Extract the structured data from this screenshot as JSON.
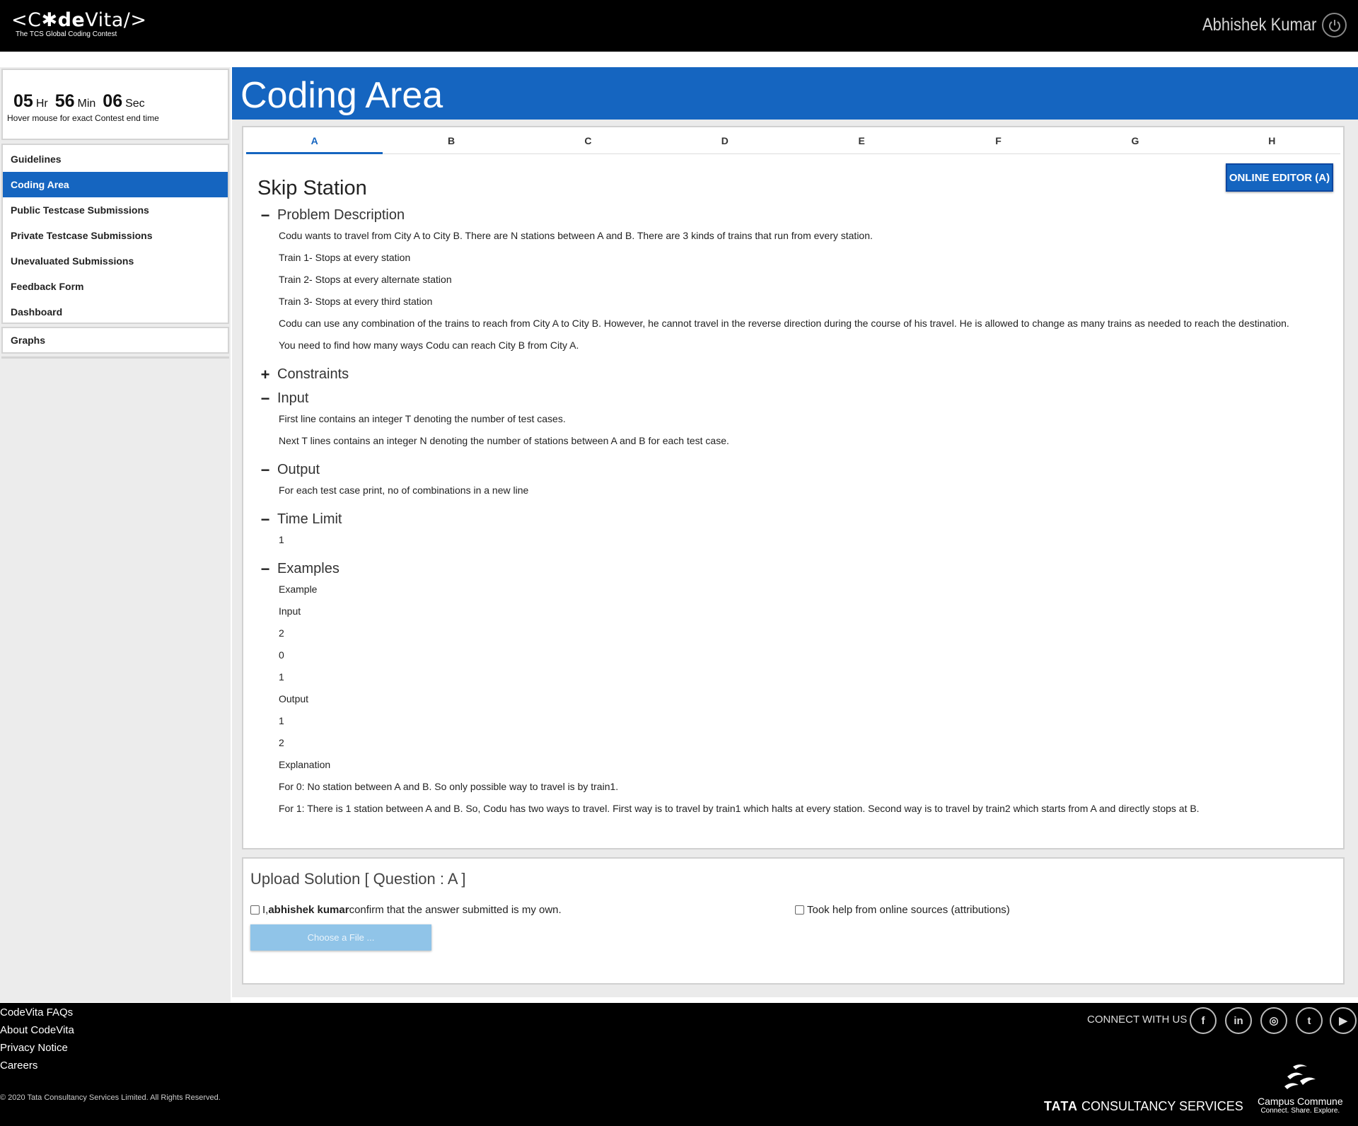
{
  "header": {
    "logo_text_1": "<C",
    "logo_star": "✱",
    "logo_text_2": "de",
    "logo_text_3": "Vita/>",
    "logo_sub": "The TCS Global Coding Contest",
    "user_name": "Abhishek Kumar"
  },
  "timer": {
    "hours": "05",
    "hr_unit": "Hr",
    "minutes": "56",
    "min_unit": "Min",
    "seconds": "06",
    "sec_unit": "Sec",
    "hint": "Hover mouse for exact Contest end time"
  },
  "sidebar": {
    "items": [
      {
        "label": "Guidelines"
      },
      {
        "label": "Coding Area"
      },
      {
        "label": "Public Testcase Submissions"
      },
      {
        "label": "Private Testcase Submissions"
      },
      {
        "label": "Unevaluated Submissions"
      },
      {
        "label": "Feedback Form"
      },
      {
        "label": "Dashboard"
      }
    ],
    "active_index": 1,
    "graphs": "Graphs"
  },
  "main": {
    "title": "Coding Area",
    "tabs": [
      "A",
      "B",
      "C",
      "D",
      "E",
      "F",
      "G",
      "H"
    ],
    "active_tab": "A",
    "editor_button": "ONLINE EDITOR (A)",
    "problem_title": "Skip Station",
    "sections": {
      "description": {
        "icon": "−",
        "title": "Problem Description",
        "lines": [
          "Codu wants to travel from City A to City B. There are N stations between A and B. There are 3 kinds of trains that run from every station.",
          "Train 1- Stops at every station",
          "Train 2- Stops at every alternate station",
          "Train 3- Stops at every third station",
          "Codu can use any combination of the trains to reach from City A to City B. However, he cannot travel in the reverse direction during the course of his travel. He is allowed to change as many trains as needed to reach the destination.",
          "You need to find how many ways Codu can reach City B from City A."
        ]
      },
      "constraints": {
        "icon": "+",
        "title": "Constraints"
      },
      "input": {
        "icon": "−",
        "title": "Input",
        "lines": [
          "First line contains an integer T denoting the number of test cases.",
          "Next T lines contains an integer N denoting the number of stations between A and B for each test case."
        ]
      },
      "output": {
        "icon": "−",
        "title": "Output",
        "lines": [
          "For each test case print, no of combinations in a new line"
        ]
      },
      "time_limit": {
        "icon": "−",
        "title": "Time Limit",
        "lines": [
          "1"
        ]
      },
      "examples": {
        "icon": "−",
        "title": "Examples",
        "lines": [
          "Example",
          "Input",
          "2",
          "0",
          "1",
          "Output",
          "1",
          "2",
          "Explanation",
          "For 0: No station between A and B. So only possible way to travel is by train1.",
          "For 1: There is 1 station between A and B. So, Codu has two ways to travel. First way is to travel by train1 which halts at every station. Second way is to travel by train2 which starts from A and directly stops at B."
        ]
      }
    }
  },
  "upload": {
    "title": "Upload Solution [ Question : A ]",
    "confirm_prefix": "I, ",
    "confirm_name": "abhishek kumar",
    "confirm_suffix": " confirm that the answer submitted is my own.",
    "help_label": "Took help from online sources (attributions)",
    "file_button": "Choose a File ..."
  },
  "footer": {
    "links": [
      "CodeVita FAQs",
      "About CodeVita",
      "Privacy Notice",
      "Careers"
    ],
    "copyright": "© 2020 Tata Consultancy Services Limited. All Rights Reserved.",
    "connect": "CONNECT WITH US",
    "social": [
      {
        "icon": "facebook-icon",
        "glyph": "f"
      },
      {
        "icon": "linkedin-icon",
        "glyph": "in"
      },
      {
        "icon": "instagram-icon",
        "glyph": "◎"
      },
      {
        "icon": "twitter-icon",
        "glyph": "t"
      },
      {
        "icon": "youtube-icon",
        "glyph": "▶"
      }
    ],
    "tcs_bold": "TATA",
    "tcs_rest": " CONSULTANCY SERVICES",
    "cc_name": "Campus Commune",
    "cc_tag": "Connect. Share. Explore."
  },
  "colors": {
    "brand_blue": "#1565c0",
    "header_bg": "#000000",
    "file_button": "#90c4e8"
  }
}
